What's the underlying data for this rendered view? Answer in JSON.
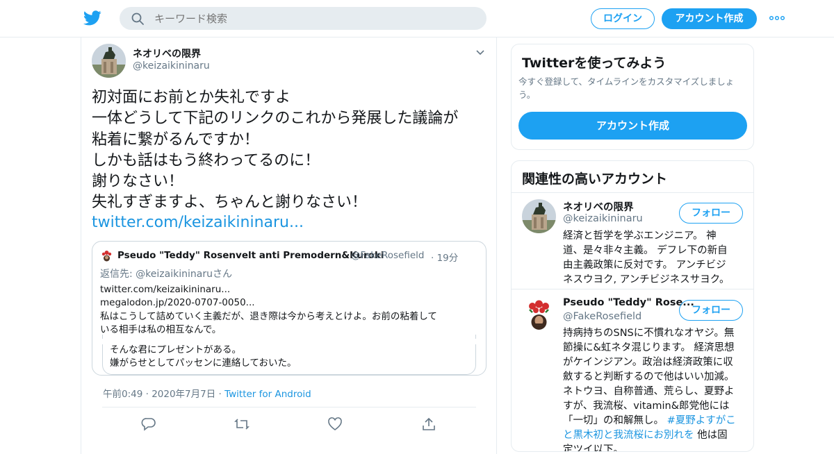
{
  "colors": {
    "accent": "#1da1f2",
    "link": "#1b95e0",
    "muted": "#657786",
    "border": "#e6ecf0"
  },
  "header": {
    "search_placeholder": "キーワード検索",
    "login_label": "ログイン",
    "signup_label": "アカウント作成"
  },
  "tweet": {
    "author_name": "ネオリベの限界",
    "author_handle": "@keizaikininaru",
    "lines": [
      "初対面にお前とか失礼ですよ",
      "一体どうして下記のリンクのこれから発展した議論が",
      "粘着に繋がるんですか！",
      "しかも話はもう終わってるのに！",
      "謝りなさい！",
      "失礼すぎますよ、ちゃんと謝りなさい！"
    ],
    "link": "twitter.com/keizaikininaru...",
    "quote": {
      "name": "Pseudo \"Teddy\" Rosenvelt anti Premodern&Kuroki",
      "handle": "@FakeRosefield",
      "time": "· 19分",
      "reply_prefix": "返信先: ",
      "reply_to": "@keizaikininaruさん",
      "lines": [
        "twitter.com/keizaikininaru...",
        "megalodon.jp/2020-0707-0050...",
        "私はこうして詰めていく主義だが、退き際は今から考えとけよ。お前の粘着して",
        "いる相手は私の相互なんで。"
      ]
    },
    "nested_lines": [
      "そんな君にプレゼントがある。",
      "嫌がらせとしてパッセンに連絡しておいた。"
    ],
    "meta_date": "午前0:49 · 2020年7月7日 · ",
    "meta_source": "Twitter for Android"
  },
  "sidebar": {
    "try_card": {
      "title": "Twitterを使ってみよう",
      "subtitle": "今すぐ登録して、タイムラインをカスタマイズしましょう。",
      "button": "アカウント作成"
    },
    "related": {
      "title": "関連性の高いアカウント",
      "follow_label": "フォロー",
      "accounts": [
        {
          "name": "ネオリベの限界",
          "handle": "@keizaikininaru",
          "bio_lines": [
            "経済と哲学を学ぶエンジニア。 神",
            "道、是々非々主義。 デフレ下の新自",
            "由主義政策に反対です。 アンチビジ",
            "ネスウヨク, アンチビジネスサヨク。"
          ]
        },
        {
          "name": "Pseudo \"Teddy\" Rose...",
          "handle": "@FakeRosefield",
          "bio_lines": [
            "持病持ちのSNSに不慣れなオヤジ。無",
            "節操に&虹ネタ混じります。 経済思想",
            "がケインジアン。政治は経済政策に収",
            "斂すると判断するので他はいい加減。",
            "ネトウヨ、自称普通、荒らし、夏野よ",
            "すが、我流桜、vitamin&郎党他には",
            "「一切」の和解無し。 "
          ],
          "bio_tag_1": "#夏野よすがこ",
          "bio_tag_2": "と黒木初と我流桜にお別れを",
          "bio_tail": " 他は固",
          "bio_last": "定ツイ以下。"
        }
      ]
    }
  }
}
